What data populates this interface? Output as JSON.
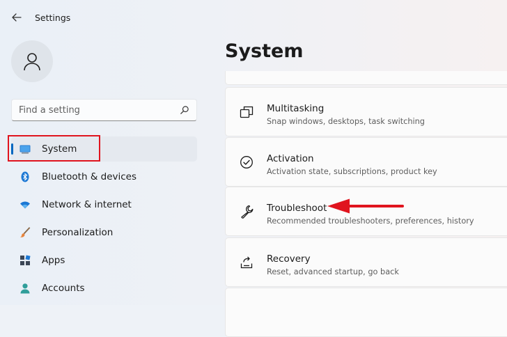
{
  "window": {
    "title": "Settings"
  },
  "sidebar": {
    "search": {
      "placeholder": "Find a setting"
    },
    "items": [
      {
        "label": "System",
        "icon": "monitor-icon",
        "active": true
      },
      {
        "label": "Bluetooth & devices",
        "icon": "bluetooth-icon"
      },
      {
        "label": "Network & internet",
        "icon": "wifi-icon"
      },
      {
        "label": "Personalization",
        "icon": "paintbrush-icon"
      },
      {
        "label": "Apps",
        "icon": "apps-icon"
      },
      {
        "label": "Accounts",
        "icon": "person-icon"
      }
    ]
  },
  "main": {
    "title": "System",
    "cards": [
      {
        "title": "Multitasking",
        "subtitle": "Snap windows, desktops, task switching",
        "icon": "multitasking-icon"
      },
      {
        "title": "Activation",
        "subtitle": "Activation state, subscriptions, product key",
        "icon": "check-circle-icon"
      },
      {
        "title": "Troubleshoot",
        "subtitle": "Recommended troubleshooters, preferences, history",
        "icon": "wrench-icon"
      },
      {
        "title": "Recovery",
        "subtitle": "Reset, advanced startup, go back",
        "icon": "recovery-icon"
      }
    ]
  },
  "colors": {
    "accent": "#0067c0",
    "annotation": "#e0141e"
  }
}
